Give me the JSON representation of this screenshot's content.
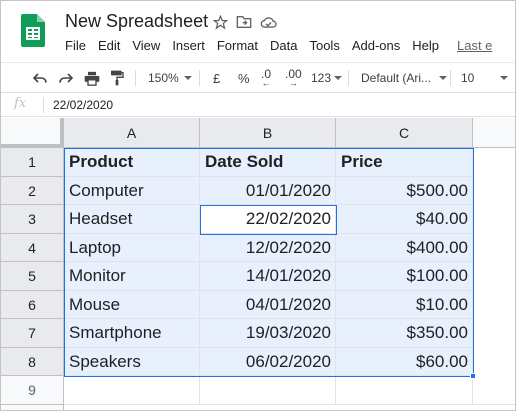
{
  "app": {
    "doc_title": "New Spreadsheet",
    "icons": [
      "star-icon",
      "move-to-folder-icon",
      "cloud-status-icon"
    ],
    "menu": [
      "File",
      "Edit",
      "View",
      "Insert",
      "Format",
      "Data",
      "Tools",
      "Add-ons",
      "Help"
    ],
    "last_edit": "Last e"
  },
  "toolbar": {
    "zoom": "150%",
    "currency": "£",
    "percent": "%",
    "dec_decrease": ".0",
    "dec_increase": ".00",
    "more_formats": "123",
    "font_family": "Default (Ari...",
    "font_size": "10"
  },
  "formula_bar": {
    "fx_label": "fx",
    "value": "22/02/2020"
  },
  "sheet": {
    "columns": [
      "A",
      "B",
      "C"
    ],
    "rows": [
      "1",
      "2",
      "3",
      "4",
      "5",
      "6",
      "7",
      "8",
      "9"
    ],
    "header_row": [
      "Product",
      "Date Sold",
      "Price"
    ],
    "data": [
      [
        "Computer",
        "01/01/2020",
        "$500.00"
      ],
      [
        "Headset",
        "22/02/2020",
        "$40.00"
      ],
      [
        "Laptop",
        "12/02/2020",
        "$400.00"
      ],
      [
        "Monitor",
        "14/01/2020",
        "$100.00"
      ],
      [
        "Mouse",
        "04/01/2020",
        "$10.00"
      ],
      [
        "Smartphone",
        "19/03/2020",
        "$350.00"
      ],
      [
        "Speakers",
        "06/02/2020",
        "$60.00"
      ]
    ],
    "selection": "A1:C8",
    "active_cell": "B3"
  },
  "colors": {
    "selection_fill": "#e8f0fe",
    "selection_border": "#1a73e8",
    "sheets_green": "#0f9d58"
  }
}
